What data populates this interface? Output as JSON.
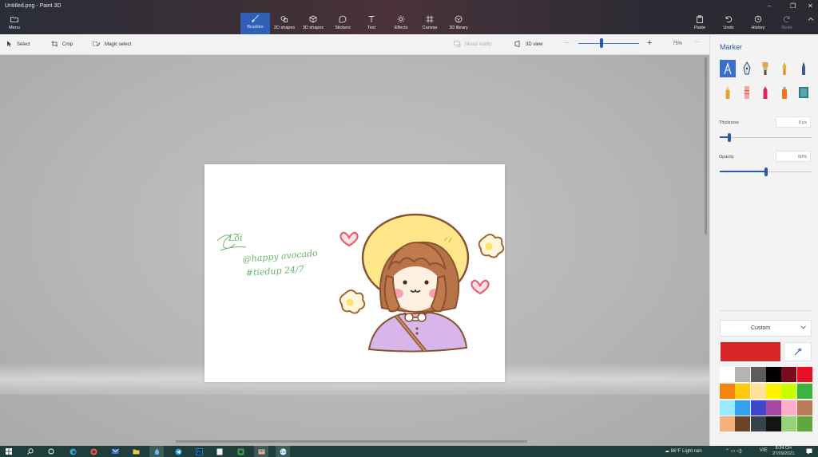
{
  "window": {
    "title": "Untitled.png - Paint 3D",
    "controls": [
      "–",
      "❐",
      "✕"
    ]
  },
  "ribbon": {
    "menu_label": "Menu",
    "tools": [
      {
        "label": "Brushes",
        "icon": "brush-icon",
        "active": true
      },
      {
        "label": "2D shapes",
        "icon": "2d-shapes-icon"
      },
      {
        "label": "3D shapes",
        "icon": "3d-shapes-icon"
      },
      {
        "label": "Stickers",
        "icon": "stickers-icon"
      },
      {
        "label": "Text",
        "icon": "text-icon"
      },
      {
        "label": "Effects",
        "icon": "effects-icon"
      },
      {
        "label": "Canvas",
        "icon": "canvas-icon"
      },
      {
        "label": "3D library",
        "icon": "3d-library-icon"
      }
    ],
    "paste_label": "Paste",
    "undo_label": "Undo",
    "history_label": "History",
    "redo_label": "Redo"
  },
  "commandbar": {
    "select_label": "Select",
    "crop_label": "Crop",
    "magic_select_label": "Magic select",
    "mixed_reality_label": "Mixed reality",
    "view3d_label": "3D view",
    "zoom_minus": "—",
    "zoom_plus": "+",
    "zoom_value": "75%",
    "more": "···"
  },
  "canvas_art": {
    "signature": "Lối",
    "handle": "@happy avocado",
    "hashtag": "#tiedup 24/7"
  },
  "panel": {
    "title": "Marker",
    "thickness_label": "Thickness",
    "thickness_value": "9 px",
    "thickness_fraction": 0.1,
    "opacity_label": "Opacity",
    "opacity_value": "50%",
    "opacity_fraction": 0.5,
    "color_mode": "Custom",
    "current_color": "#d82626",
    "palette": [
      "#ffffff",
      "#b4b4b4",
      "#5c5c5c",
      "#000000",
      "#7a0a1c",
      "#e81123",
      "#f7830f",
      "#ffc90e",
      "#fbe29d",
      "#fff200",
      "#c8ff00",
      "#3eb23f",
      "#99eaff",
      "#31a1f0",
      "#3f48cc",
      "#a349a4",
      "#ffaec9",
      "#b97a57",
      "#f2b27a",
      "#6b4328",
      "#36424a",
      "#141414",
      "#98d278",
      "#5fa83c"
    ]
  },
  "taskbar": {
    "weather": "86°F  Light rain",
    "lang": "VIE",
    "time": "8:34 CH",
    "date": "27/09/2021"
  }
}
